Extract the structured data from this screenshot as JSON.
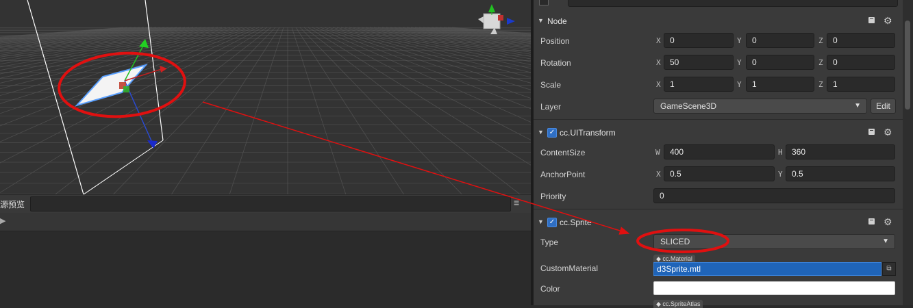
{
  "scene": {
    "gizmo_axes": [
      "y-axis",
      "x-axis",
      "z-axis"
    ]
  },
  "assets": {
    "title": "源预览",
    "menu_icon": "hamburger-icon",
    "search_placeholder": ""
  },
  "inspector": {
    "node": {
      "title": "Node",
      "position": {
        "label": "Position",
        "x": "0",
        "y": "0",
        "z": "0"
      },
      "rotation": {
        "label": "Rotation",
        "x": "50",
        "y": "0",
        "z": "0"
      },
      "scale": {
        "label": "Scale",
        "x": "1",
        "y": "1",
        "z": "1"
      },
      "layer": {
        "label": "Layer",
        "value": "GameScene3D",
        "edit": "Edit"
      }
    },
    "uitransform": {
      "title": "cc.UITransform",
      "content_size": {
        "label": "ContentSize",
        "w": "400",
        "h": "360"
      },
      "anchor_point": {
        "label": "AnchorPoint",
        "x": "0.5",
        "y": "0.5"
      },
      "priority": {
        "label": "Priority",
        "value": "0"
      }
    },
    "sprite": {
      "title": "cc.Sprite",
      "type": {
        "label": "Type",
        "value": "SLICED"
      },
      "custom_material": {
        "label": "CustomMaterial",
        "tag": "cc.Material",
        "value": "d3Sprite.mtl"
      },
      "color": {
        "label": "Color",
        "value": "#ffffff"
      },
      "sprite_atlas_tag": "cc.SpriteAtlas"
    },
    "axis_letters": {
      "x": "X",
      "y": "Y",
      "z": "Z",
      "w": "W",
      "h": "H"
    }
  },
  "annotation_color": "#e01010",
  "accent_color": "#1f64b8"
}
